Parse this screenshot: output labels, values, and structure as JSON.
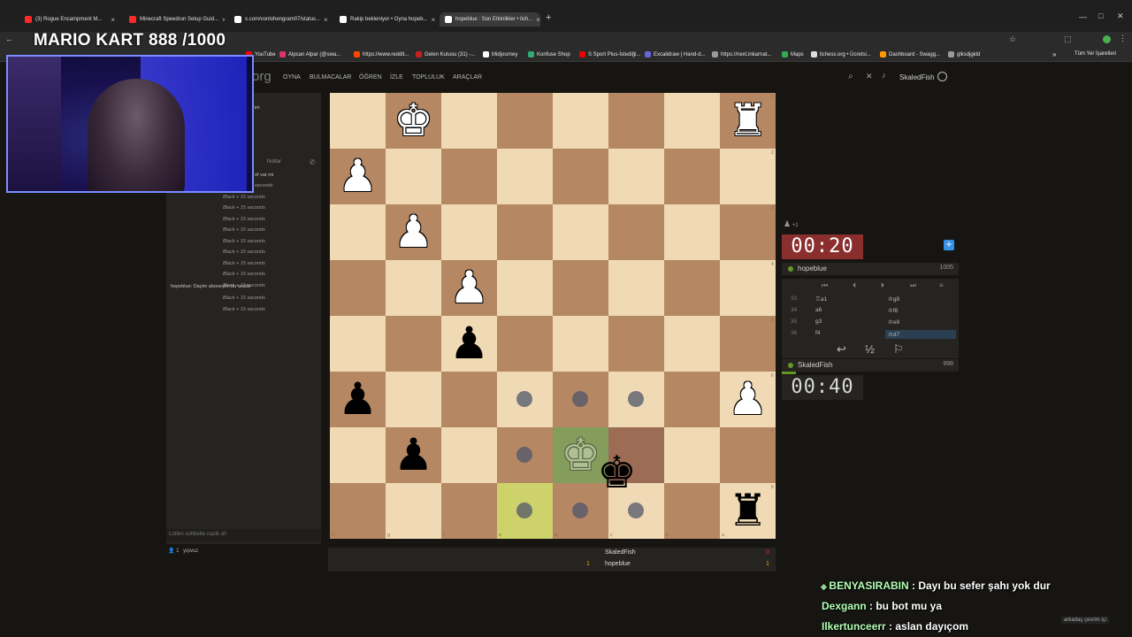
{
  "browser": {
    "tabs": [
      {
        "label": "(3) Rogue Encampment M...",
        "fav": "#ff2a2a"
      },
      {
        "label": "Minecraft Speedrun Setup Guid...",
        "fav": "#ff2a2a"
      },
      {
        "label": "x.com/vonlohengram07/status...",
        "fav": "#ffffff"
      },
      {
        "label": "Rakip bekleniyor • Oyna hopeb...",
        "fav": "#ffffff"
      },
      {
        "label": "hopeblue : Son Etkinlikler • lich...",
        "fav": "#ffffff"
      }
    ],
    "bookmarks": [
      "YouTube",
      "Alpcan Alpar (@swa...",
      "https://www.reddit...",
      "Gelen Kutusu (31) -...",
      "Midjourney",
      "Konfuse Shop",
      "S Sport Plus-İstediği...",
      "Excalidraw | Hand-d...",
      "https://next.inkarnat...",
      "Maps",
      "lichess.org • Ücretsi...",
      "Dashboard - Swagg...",
      "glksdjgkld"
    ],
    "bookmarks_all": "Tüm Yer İşaretleri"
  },
  "overlay": {
    "title": "MARIO KART   888 /1000"
  },
  "site": {
    "logo_suffix": "org",
    "nav": [
      "OYNA",
      "BULMACALAR",
      "ÖĞREN",
      "İZLE",
      "TOPLULUK",
      "ARAÇLAR"
    ],
    "username": "SkaledFish"
  },
  "chat": {
    "notes_label": "Notlar",
    "fragment_1": "nm",
    "first_line": "of var mi",
    "lines": [
      "seconds",
      "Black + 15 seconds",
      "Black + 15 seconds",
      "Black + 15 seconds",
      "Black + 15 seconds",
      "Black + 15 seconds",
      "Black + 15 seconds",
      "Black + 15 seconds",
      "Black + 15 seconds",
      "Black + 15 seconds"
    ],
    "user_message": "hopeblue: Dayim aboneyim bu arada",
    "after_lines": [
      "Black + 15 seconds",
      "Black + 15 seconds"
    ],
    "input_placeholder": "Lütfen sohbette nazik ol!",
    "spectators": "yqwuz",
    "spectator_count": "1"
  },
  "board": {
    "ranks": [
      "1",
      "2",
      "3",
      "4",
      "5",
      "6",
      "7",
      "8"
    ],
    "files": [
      "h",
      "g",
      "f",
      "e",
      "d",
      "c",
      "b",
      "a"
    ],
    "pieces": [
      {
        "r": 0,
        "c": 1,
        "g": "♚",
        "side": "w",
        "name": "white-king-icon"
      },
      {
        "r": 0,
        "c": 7,
        "g": "♜",
        "side": "w",
        "name": "white-rook-icon"
      },
      {
        "r": 1,
        "c": 0,
        "g": "♟",
        "side": "w",
        "name": "white-pawn-icon"
      },
      {
        "r": 2,
        "c": 1,
        "g": "♟",
        "side": "w",
        "name": "white-pawn-icon"
      },
      {
        "r": 3,
        "c": 2,
        "g": "♟",
        "side": "w",
        "name": "white-pawn-icon"
      },
      {
        "r": 4,
        "c": 2,
        "g": "♟",
        "side": "b",
        "name": "black-pawn-icon"
      },
      {
        "r": 5,
        "c": 0,
        "g": "♟",
        "side": "b",
        "name": "black-pawn-icon"
      },
      {
        "r": 5,
        "c": 7,
        "g": "♟",
        "side": "w",
        "name": "white-pawn-icon"
      },
      {
        "r": 6,
        "c": 1,
        "g": "♟",
        "side": "b",
        "name": "black-pawn-icon"
      },
      {
        "r": 6,
        "c": 4,
        "g": "♚",
        "side": "ghost",
        "name": "black-king-ghost-icon"
      },
      {
        "r": 6,
        "c": 5,
        "g": "♚",
        "side": "b",
        "name": "black-king-icon"
      },
      {
        "r": 7,
        "c": 7,
        "g": "♜",
        "side": "b",
        "name": "black-rook-icon"
      }
    ],
    "dots": [
      [
        5,
        3
      ],
      [
        5,
        4
      ],
      [
        5,
        5
      ],
      [
        6,
        3
      ],
      [
        7,
        3
      ],
      [
        7,
        4
      ],
      [
        7,
        5
      ]
    ],
    "highlights": {
      "selected": [
        6,
        4
      ],
      "last_move": [
        7,
        3
      ],
      "drag_target": [
        6,
        5
      ]
    }
  },
  "score": {
    "top_name": "SkaledFish",
    "top_score": "0",
    "bottom_name": "hopeblue",
    "bottom_score": "1",
    "left_score": "1"
  },
  "clock": {
    "opponent": "00:20",
    "player": "00:40",
    "material": "+1"
  },
  "players": {
    "opponent": {
      "name": "hopeblue",
      "rating": "1005"
    },
    "player": {
      "name": "SkaledFish",
      "rating": "998"
    }
  },
  "moves": [
    {
      "n": "33",
      "w": "♖a1",
      "b": "♔g8"
    },
    {
      "n": "34",
      "w": "a6",
      "b": "♔f8"
    },
    {
      "n": "35",
      "w": "g3",
      "b": "♔e8"
    },
    {
      "n": "36",
      "w": "f4",
      "b": "♔d7"
    }
  ],
  "controls": {
    "takeback": "↩",
    "draw": "½",
    "resign": "⚐"
  },
  "stream_chat": [
    {
      "user": "BENYASIRABIN",
      "msg": " : Dayı bu sefer şahı yok dur"
    },
    {
      "user": "Dexgann",
      "msg": " : bu bot mu ya"
    },
    {
      "user": "Ilkertunceerr",
      "msg": " : aslan dayıçom"
    }
  ],
  "footer_hint": "arkadaş çevrim içi"
}
